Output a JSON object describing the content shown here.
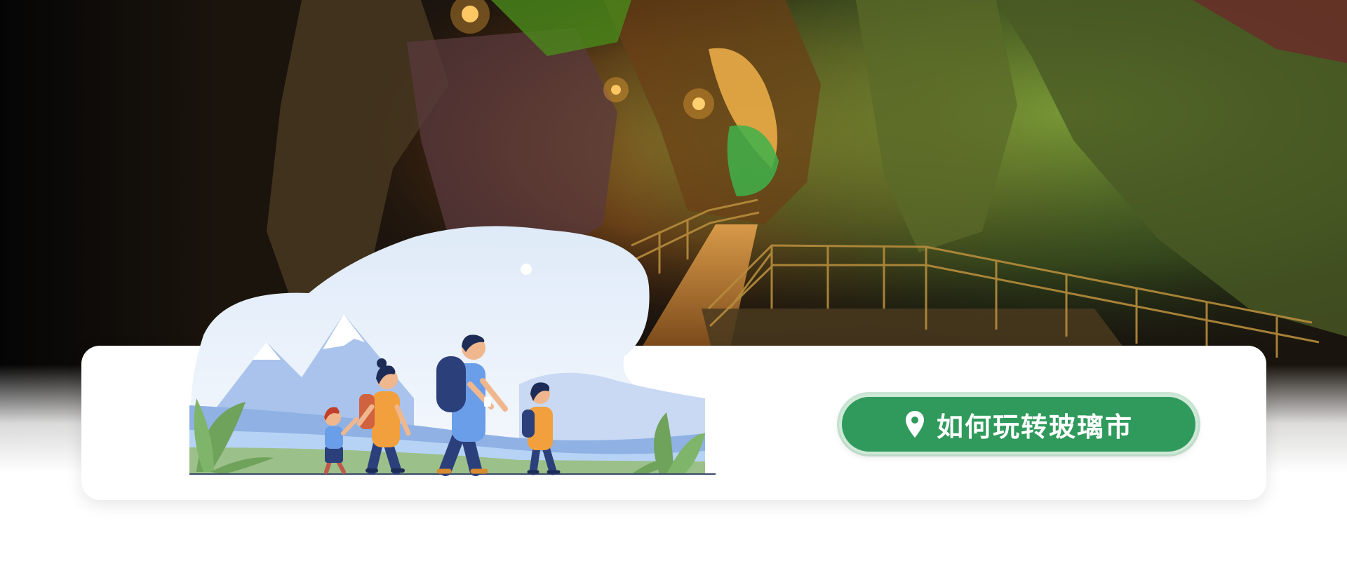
{
  "hero": {
    "image": "cave-walkway-photo",
    "cta": {
      "label": "如何玩转玻璃市",
      "icon": "map-pin-icon",
      "color": "#2f9a5c"
    },
    "illustration": "family-hiking-illustration"
  }
}
